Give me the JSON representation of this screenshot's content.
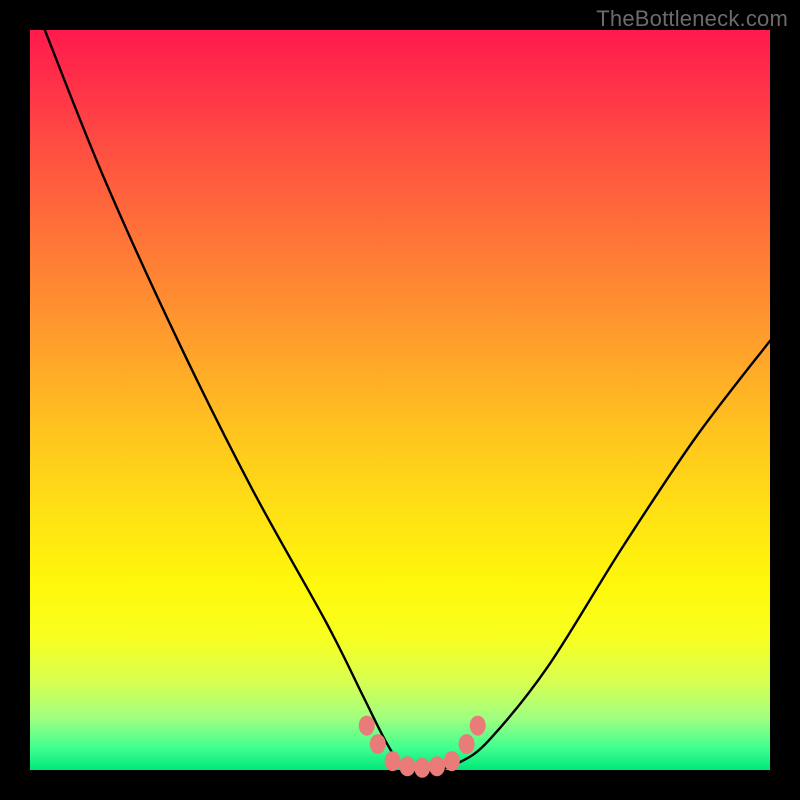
{
  "watermark": "TheBottleneck.com",
  "chart_data": {
    "type": "line",
    "title": "",
    "xlabel": "",
    "ylabel": "",
    "xlim": [
      0,
      100
    ],
    "ylim": [
      0,
      100
    ],
    "series": [
      {
        "name": "bottleneck-curve",
        "x": [
          2,
          10,
          20,
          30,
          40,
          45,
          48,
          50,
          52,
          55,
          58,
          62,
          70,
          80,
          90,
          100
        ],
        "y": [
          100,
          80,
          58,
          38,
          20,
          10,
          4,
          1,
          0,
          0,
          1,
          4,
          14,
          30,
          45,
          58
        ]
      }
    ],
    "markers": {
      "name": "highlight-dots",
      "x": [
        45.5,
        47,
        49,
        51,
        53,
        55,
        57,
        59,
        60.5
      ],
      "y": [
        6,
        3.5,
        1.2,
        0.5,
        0.3,
        0.5,
        1.2,
        3.5,
        6
      ]
    },
    "colors": {
      "curve": "#000000",
      "markers": "#e97b78",
      "gradient_top": "#ff1a4d",
      "gradient_bottom": "#00e97a"
    }
  }
}
